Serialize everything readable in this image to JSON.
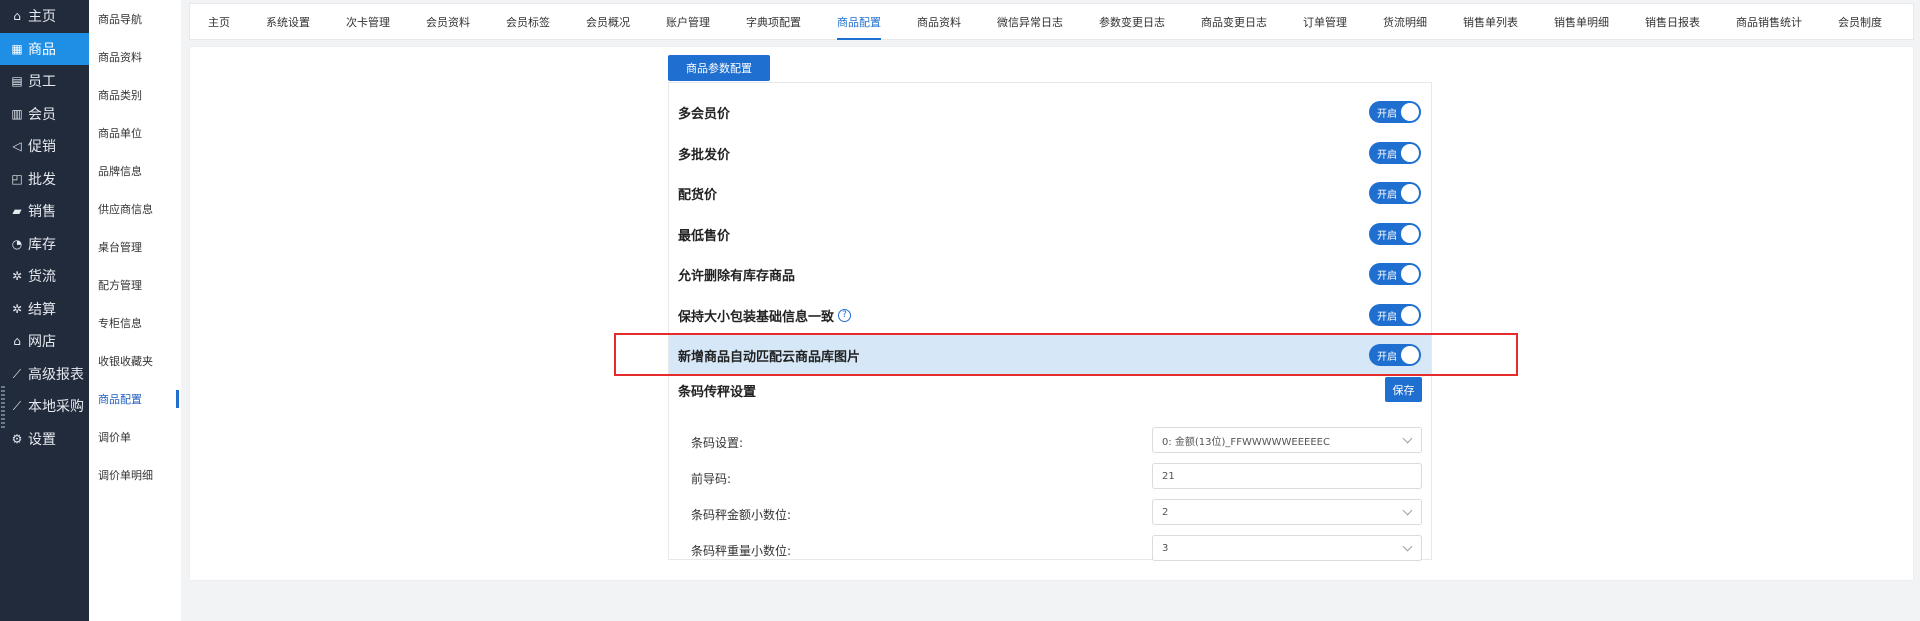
{
  "nav": {
    "items": [
      {
        "label": "主页",
        "icon": "home-icon",
        "glyph": "⌂"
      },
      {
        "label": "商品",
        "icon": "grid-icon",
        "glyph": "▦"
      },
      {
        "label": "员工",
        "icon": "document-icon",
        "glyph": "▤"
      },
      {
        "label": "会员",
        "icon": "member-icon",
        "glyph": "▥"
      },
      {
        "label": "促销",
        "icon": "send-icon",
        "glyph": "◁"
      },
      {
        "label": "批发",
        "icon": "box-icon",
        "glyph": "◰"
      },
      {
        "label": "销售",
        "icon": "chart-icon",
        "glyph": "▰"
      },
      {
        "label": "库存",
        "icon": "pie-icon",
        "glyph": "◔"
      },
      {
        "label": "货流",
        "icon": "gear-icon",
        "glyph": "✲"
      },
      {
        "label": "结算",
        "icon": "settlement-icon",
        "glyph": "✲"
      },
      {
        "label": "网店",
        "icon": "shop-icon",
        "glyph": "⌂"
      },
      {
        "label": "高级报表",
        "icon": "report-icon",
        "glyph": "⟋"
      },
      {
        "label": "本地采购",
        "icon": "purchase-icon",
        "glyph": "⟋"
      },
      {
        "label": "设置",
        "icon": "settings-icon",
        "glyph": "⚙"
      }
    ],
    "active_index": 1
  },
  "submenu": {
    "items": [
      "商品导航",
      "商品资料",
      "商品类别",
      "商品单位",
      "品牌信息",
      "供应商信息",
      "桌台管理",
      "配方管理",
      "专柜信息",
      "收银收藏夹",
      "商品配置",
      "调价单",
      "调价单明细"
    ],
    "active_index": 10
  },
  "tabs": {
    "items": [
      "主页",
      "系统设置",
      "次卡管理",
      "会员资料",
      "会员标签",
      "会员概况",
      "账户管理",
      "字典项配置",
      "商品配置",
      "商品资料",
      "微信异常日志",
      "参数变更日志",
      "商品变更日志",
      "订单管理",
      "货流明细",
      "销售单列表",
      "销售单明细",
      "销售日报表",
      "商品销售统计",
      "会员制度"
    ],
    "active_index": 8
  },
  "config": {
    "tab_label": "商品参数配置",
    "toggle_on_label": "开启",
    "rows": [
      {
        "label": "多会员价",
        "on": true
      },
      {
        "label": "多批发价",
        "on": true
      },
      {
        "label": "配货价",
        "on": true
      },
      {
        "label": "最低售价",
        "on": true
      },
      {
        "label": "允许删除有库存商品",
        "on": true
      },
      {
        "label": "保持大小包装基础信息一致",
        "on": true,
        "help": true
      },
      {
        "label": "新增商品自动匹配云商品库图片",
        "on": true,
        "highlighted": true
      }
    ],
    "help_glyph": "?"
  },
  "barcode": {
    "title": "条码传秤设置",
    "save_label": "保存",
    "fields": [
      {
        "label": "条码设置:",
        "value": "0: 金额(13位)_FFWWWWWEEEEEC",
        "type": "select"
      },
      {
        "label": "前导码:",
        "value": "21",
        "type": "input"
      },
      {
        "label": "条码秤金额小数位:",
        "value": "2",
        "type": "select"
      },
      {
        "label": "条码秤重量小数位:",
        "value": "3",
        "type": "select"
      }
    ]
  }
}
